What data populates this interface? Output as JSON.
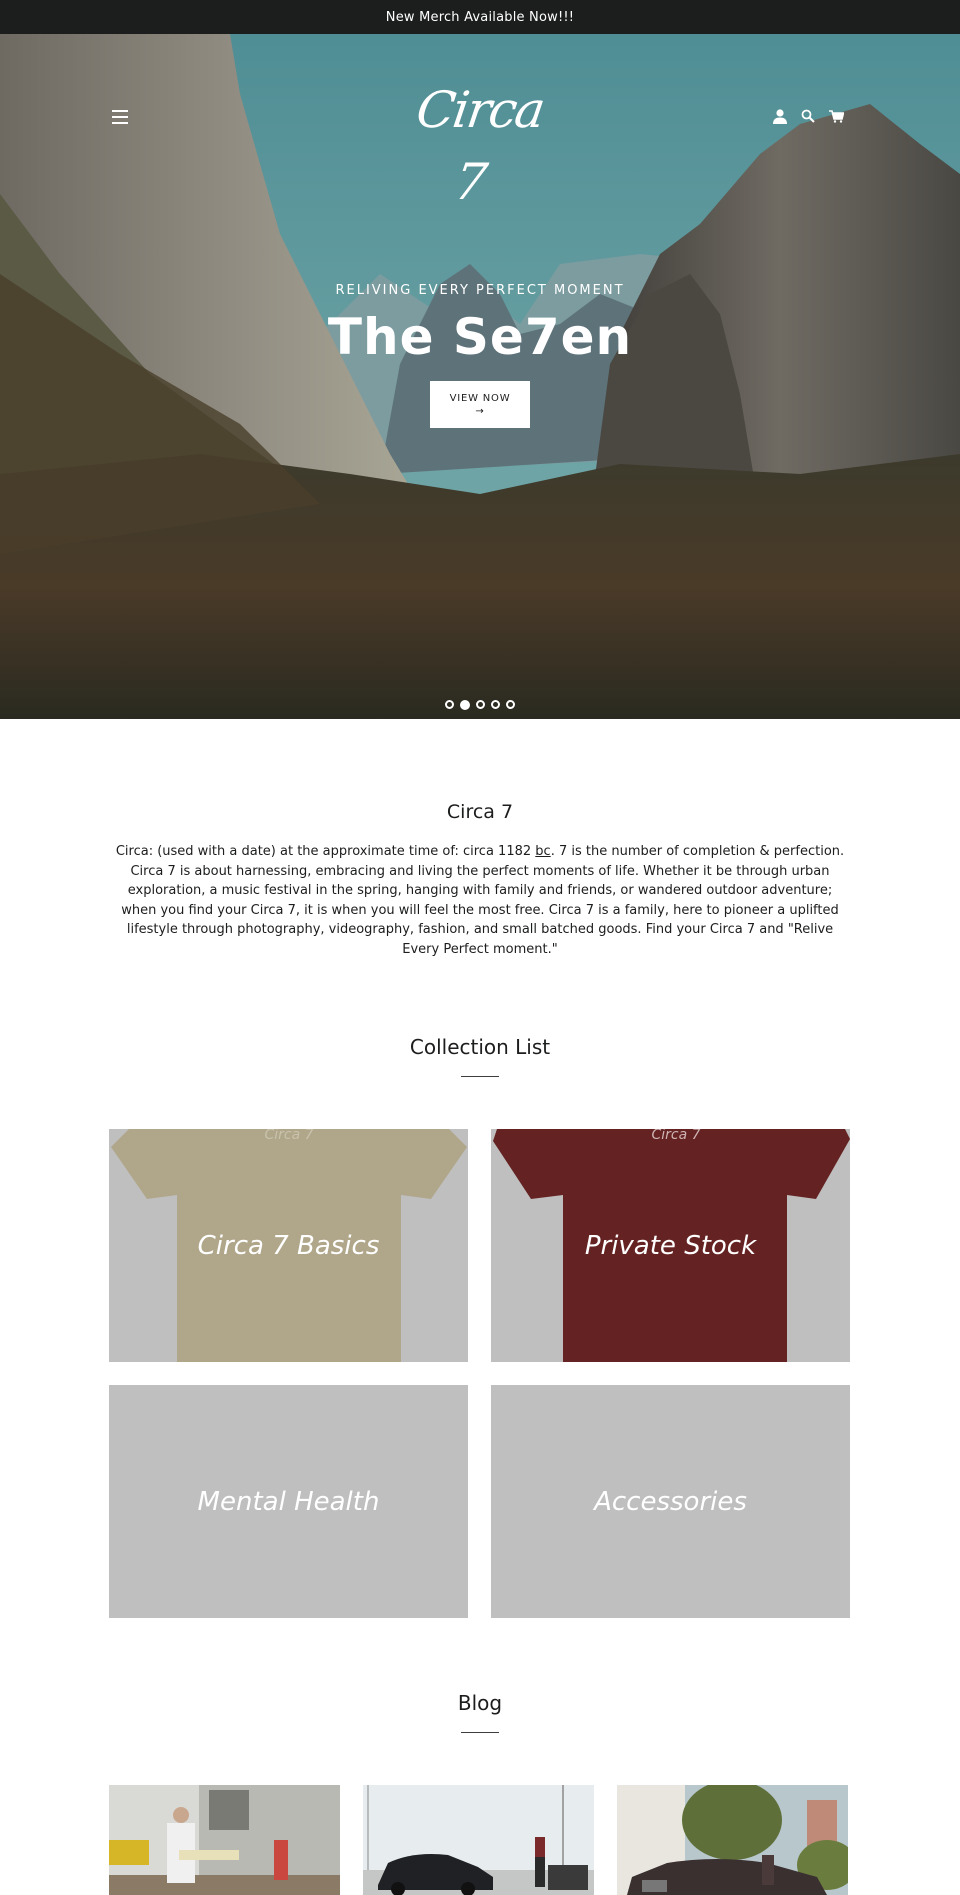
{
  "announcement": {
    "text": "New Merch Available Now!!!"
  },
  "header": {
    "logo_text": "Circa 7",
    "icons": [
      "menu-icon",
      "account-icon",
      "search-icon",
      "cart-icon"
    ]
  },
  "hero": {
    "eyebrow": "RELIVING EVERY PERFECT MOMENT",
    "title": "The Se7en",
    "button_label": "VIEW NOW",
    "button_arrow": "→",
    "slides_total": 5,
    "active_slide": 2
  },
  "about": {
    "title": "Circa 7",
    "text_before": "Circa: (used with a date) at the approximate time of: circa 1182 ",
    "underlined": "bc",
    "text_after": ".  7 is the number of completion & perfection.  Circa 7 is about harnessing, embracing and living the perfect moments of life.  Whether it be through urban exploration, a music festival in the spring, hanging with family and friends, or wandered outdoor adventure; when you find your Circa 7, it is when you will feel the most free. Circa 7 is a family, here to pioneer a uplifted lifestyle through photography, videography, fashion, and small batched goods.  Find your Circa 7 and \"Relive Every Perfect moment.\""
  },
  "collections": {
    "title": "Collection List",
    "items": [
      {
        "label": "Circa 7 Basics",
        "image": "tan-tshirt",
        "color": "#b3a88a"
      },
      {
        "label": "Private Stock",
        "image": "maroon-tshirt",
        "color": "#6b2020"
      },
      {
        "label": "Mental Health",
        "image": "placeholder"
      },
      {
        "label": "Accessories",
        "image": "placeholder"
      }
    ]
  },
  "blog": {
    "title": "Blog",
    "posts": [
      {
        "image": "man-at-glass-pavilion"
      },
      {
        "image": "black-sedan-marina"
      },
      {
        "image": "classic-car-street"
      }
    ]
  }
}
